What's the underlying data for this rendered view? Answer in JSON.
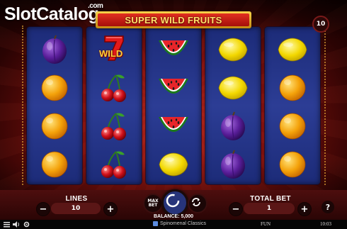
{
  "watermark": {
    "slot": "Slot",
    "catalog": "Catalog",
    "com": ".com"
  },
  "game": {
    "title": "SUPER WILD FRUITS",
    "lines_badge": "10"
  },
  "reels": [
    [
      "plum",
      "orange",
      "orange",
      "orange"
    ],
    [
      "seven-wild",
      "cherry",
      "cherry",
      "cherry"
    ],
    [
      "watermelon",
      "watermelon",
      "watermelon",
      "lemon"
    ],
    [
      "lemon",
      "lemon",
      "plum",
      "plum"
    ],
    [
      "lemon",
      "orange",
      "orange",
      "orange"
    ]
  ],
  "wild_label": "WILD",
  "controls": {
    "lines_label": "LINES",
    "lines_value": "10",
    "minus": "−",
    "plus": "+",
    "max_bet_label": "MAX BET",
    "total_bet_label": "TOTAL BET",
    "total_bet_value": "1",
    "balance": "BALANCE: 5,000",
    "help": "?"
  },
  "footer": {
    "provider": "Spinomenal Classics",
    "mode": "FUN",
    "time": "10:03"
  },
  "colors": {
    "reel_bg": "#2c3d95",
    "banner_gold": "#f7d24a",
    "banner_red": "#e23020",
    "title_text": "#ffe16a",
    "spin_button": "#27347a"
  }
}
